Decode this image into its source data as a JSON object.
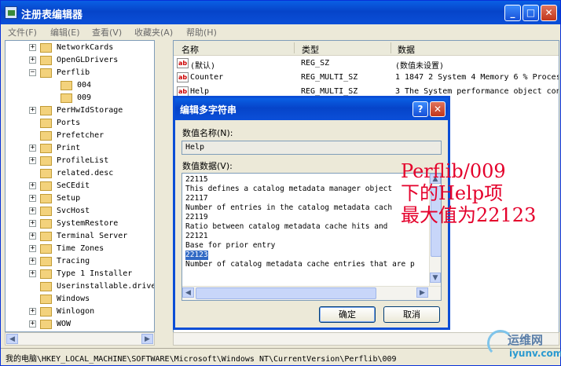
{
  "window": {
    "title": "注册表编辑器",
    "min_glyph": "_",
    "max_glyph": "□",
    "close_glyph": "✕"
  },
  "menu": [
    "文件(F)",
    "编辑(E)",
    "查看(V)",
    "收藏夹(A)",
    "帮助(H)"
  ],
  "tree": {
    "items": [
      {
        "label": "NetworkCards",
        "sign": "+"
      },
      {
        "label": "OpenGLDrivers",
        "sign": "+"
      },
      {
        "label": "Perflib",
        "sign": "−"
      },
      {
        "label": "004",
        "sign": ""
      },
      {
        "label": "009",
        "sign": ""
      },
      {
        "label": "PerHwIdStorage",
        "sign": "+"
      },
      {
        "label": "Ports",
        "sign": ""
      },
      {
        "label": "Prefetcher",
        "sign": ""
      },
      {
        "label": "Print",
        "sign": "+"
      },
      {
        "label": "ProfileList",
        "sign": "+"
      },
      {
        "label": "related.desc",
        "sign": ""
      },
      {
        "label": "SeCEdit",
        "sign": "+"
      },
      {
        "label": "Setup",
        "sign": "+"
      },
      {
        "label": "SvcHost",
        "sign": "+"
      },
      {
        "label": "SystemRestore",
        "sign": "+"
      },
      {
        "label": "Terminal Server",
        "sign": "+"
      },
      {
        "label": "Time Zones",
        "sign": "+"
      },
      {
        "label": "Tracing",
        "sign": "+"
      },
      {
        "label": "Type 1 Installer",
        "sign": "+"
      },
      {
        "label": "Userinstallable.drive",
        "sign": ""
      },
      {
        "label": "Windows",
        "sign": ""
      },
      {
        "label": "Winlogon",
        "sign": "+"
      },
      {
        "label": "WOW",
        "sign": "+"
      }
    ]
  },
  "list": {
    "columns": [
      "名称",
      "类型",
      "数据"
    ],
    "rows": [
      {
        "name": "(默认)",
        "type": "REG_SZ",
        "data": "(数值未设置)"
      },
      {
        "name": "Counter",
        "type": "REG_MULTI_SZ",
        "data": "1 1847 2 System 4 Memory 6 % Proces"
      },
      {
        "name": "Help",
        "type": "REG_MULTI_SZ",
        "data": "3 The System performance object con"
      }
    ]
  },
  "dialog": {
    "title": "编辑多字符串",
    "help_glyph": "?",
    "close_glyph": "✕",
    "name_label": "数值名称(N):",
    "name_value": "Help",
    "data_label": "数值数据(V):",
    "data_lines": [
      "22115",
      "This defines a catalog metadata manager object",
      "22117",
      "Number of entries in the catalog metadata cach",
      "22119",
      "Ratio between catalog metadata cache hits and",
      "22121",
      "Base for prior entry",
      "22123",
      "Number of catalog metadata cache entries that are p"
    ],
    "selected_line": "22123",
    "ok_label": "确定",
    "cancel_label": "取消"
  },
  "annotation": [
    "Perflib/009",
    "下的Help项",
    "最大值为22123"
  ],
  "annotation_color": "#e4002b",
  "status": "我的电脑\\HKEY_LOCAL_MACHINE\\SOFTWARE\\Microsoft\\Windows NT\\CurrentVersion\\Perflib\\009",
  "watermark": {
    "top": "运维网",
    "bottom": "iyunv.com"
  }
}
